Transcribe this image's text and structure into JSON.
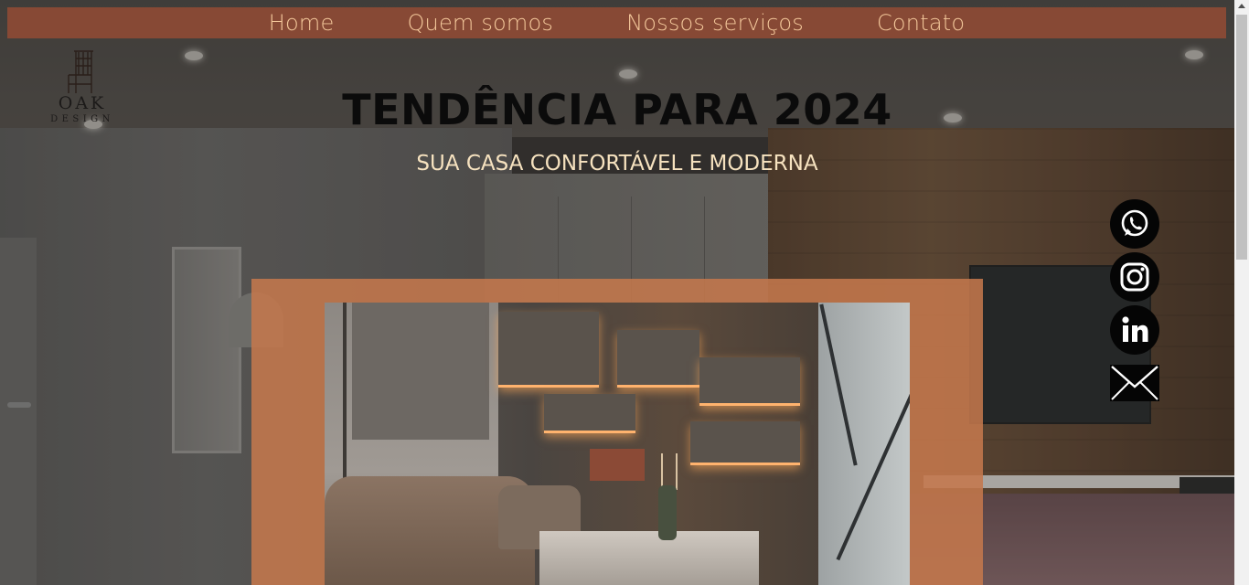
{
  "nav": {
    "items": [
      {
        "label": "Home"
      },
      {
        "label": "Quem somos"
      },
      {
        "label": "Nossos serviços"
      },
      {
        "label": "Contato"
      }
    ]
  },
  "logo": {
    "name": "OAK",
    "tagline": "DESIGN"
  },
  "hero": {
    "title": "TENDÊNCIA PARA 2024",
    "subtitle": "SUA CASA CONFORTÁVEL E MODERNA"
  },
  "social": {
    "icons": [
      "whatsapp-icon",
      "instagram-icon",
      "linkedin-icon",
      "email-icon"
    ]
  },
  "colors": {
    "nav_background": "#874935",
    "nav_text": "#f3c79a",
    "card_background": "#c4784c",
    "subtitle_text": "#f6e2bf"
  }
}
